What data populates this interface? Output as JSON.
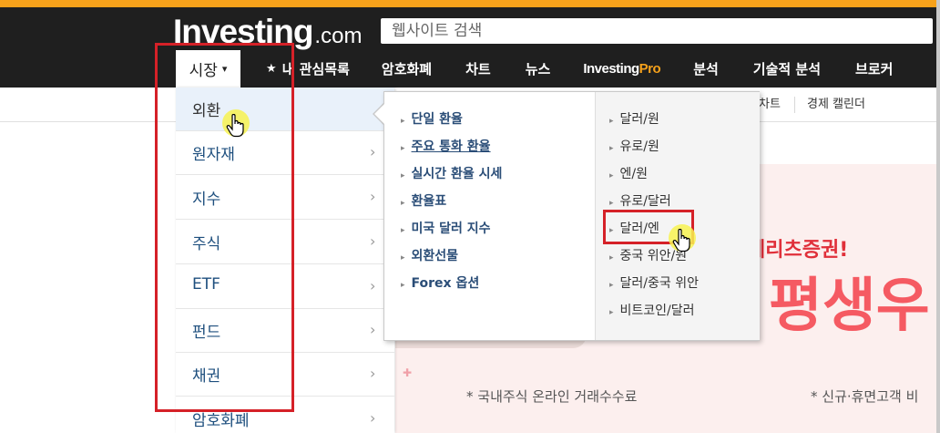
{
  "header": {
    "logo_brand": "Investing",
    "logo_suffix": ".com",
    "search_placeholder": "웹사이트 검색"
  },
  "nav": {
    "market": "시장",
    "watchlist": "내 관심목록",
    "crypto": "암호화폐",
    "chart": "차트",
    "news": "뉴스",
    "pro_brand": "Investing",
    "pro_suffix": "Pro",
    "analysis": "분석",
    "technical": "기술적 분석",
    "broker": "브로커"
  },
  "subnav": {
    "chart": "차트",
    "calendar": "경제 캘린더"
  },
  "market_menu": {
    "items": [
      {
        "label": "외환"
      },
      {
        "label": "원자재"
      },
      {
        "label": "지수"
      },
      {
        "label": "주식"
      },
      {
        "label": "ETF"
      },
      {
        "label": "펀드"
      },
      {
        "label": "채권"
      },
      {
        "label": "암호화폐"
      }
    ]
  },
  "forex_submenu": {
    "left": [
      {
        "label": "단일 환율"
      },
      {
        "label": "주요 통화 환율"
      },
      {
        "label": "실시간 환율 시세"
      },
      {
        "label": "환율표"
      },
      {
        "label": "미국 달러 지수"
      },
      {
        "label": "외환선물"
      },
      {
        "label": "Forex 옵션"
      }
    ],
    "right": [
      {
        "label": "달러/원"
      },
      {
        "label": "유로/원"
      },
      {
        "label": "엔/원"
      },
      {
        "label": "유로/달러"
      },
      {
        "label": "달러/엔"
      },
      {
        "label": "중국 위안/원"
      },
      {
        "label": "달러/중국 위안"
      },
      {
        "label": "비트코인/달러"
      }
    ]
  },
  "ad": {
    "slogan": "메리츠증권!",
    "big_text": "평생우",
    "note_left": "* 국내주식 온라인 거래수수료",
    "note_right": "* 신규·휴면고객 비"
  },
  "colors": {
    "accent_orange": "#f7a21b",
    "header_bg": "#1f1f1f",
    "link_blue": "#2a4d77",
    "annotation_red": "#d52128",
    "highlight_yellow": "#f7f250"
  }
}
